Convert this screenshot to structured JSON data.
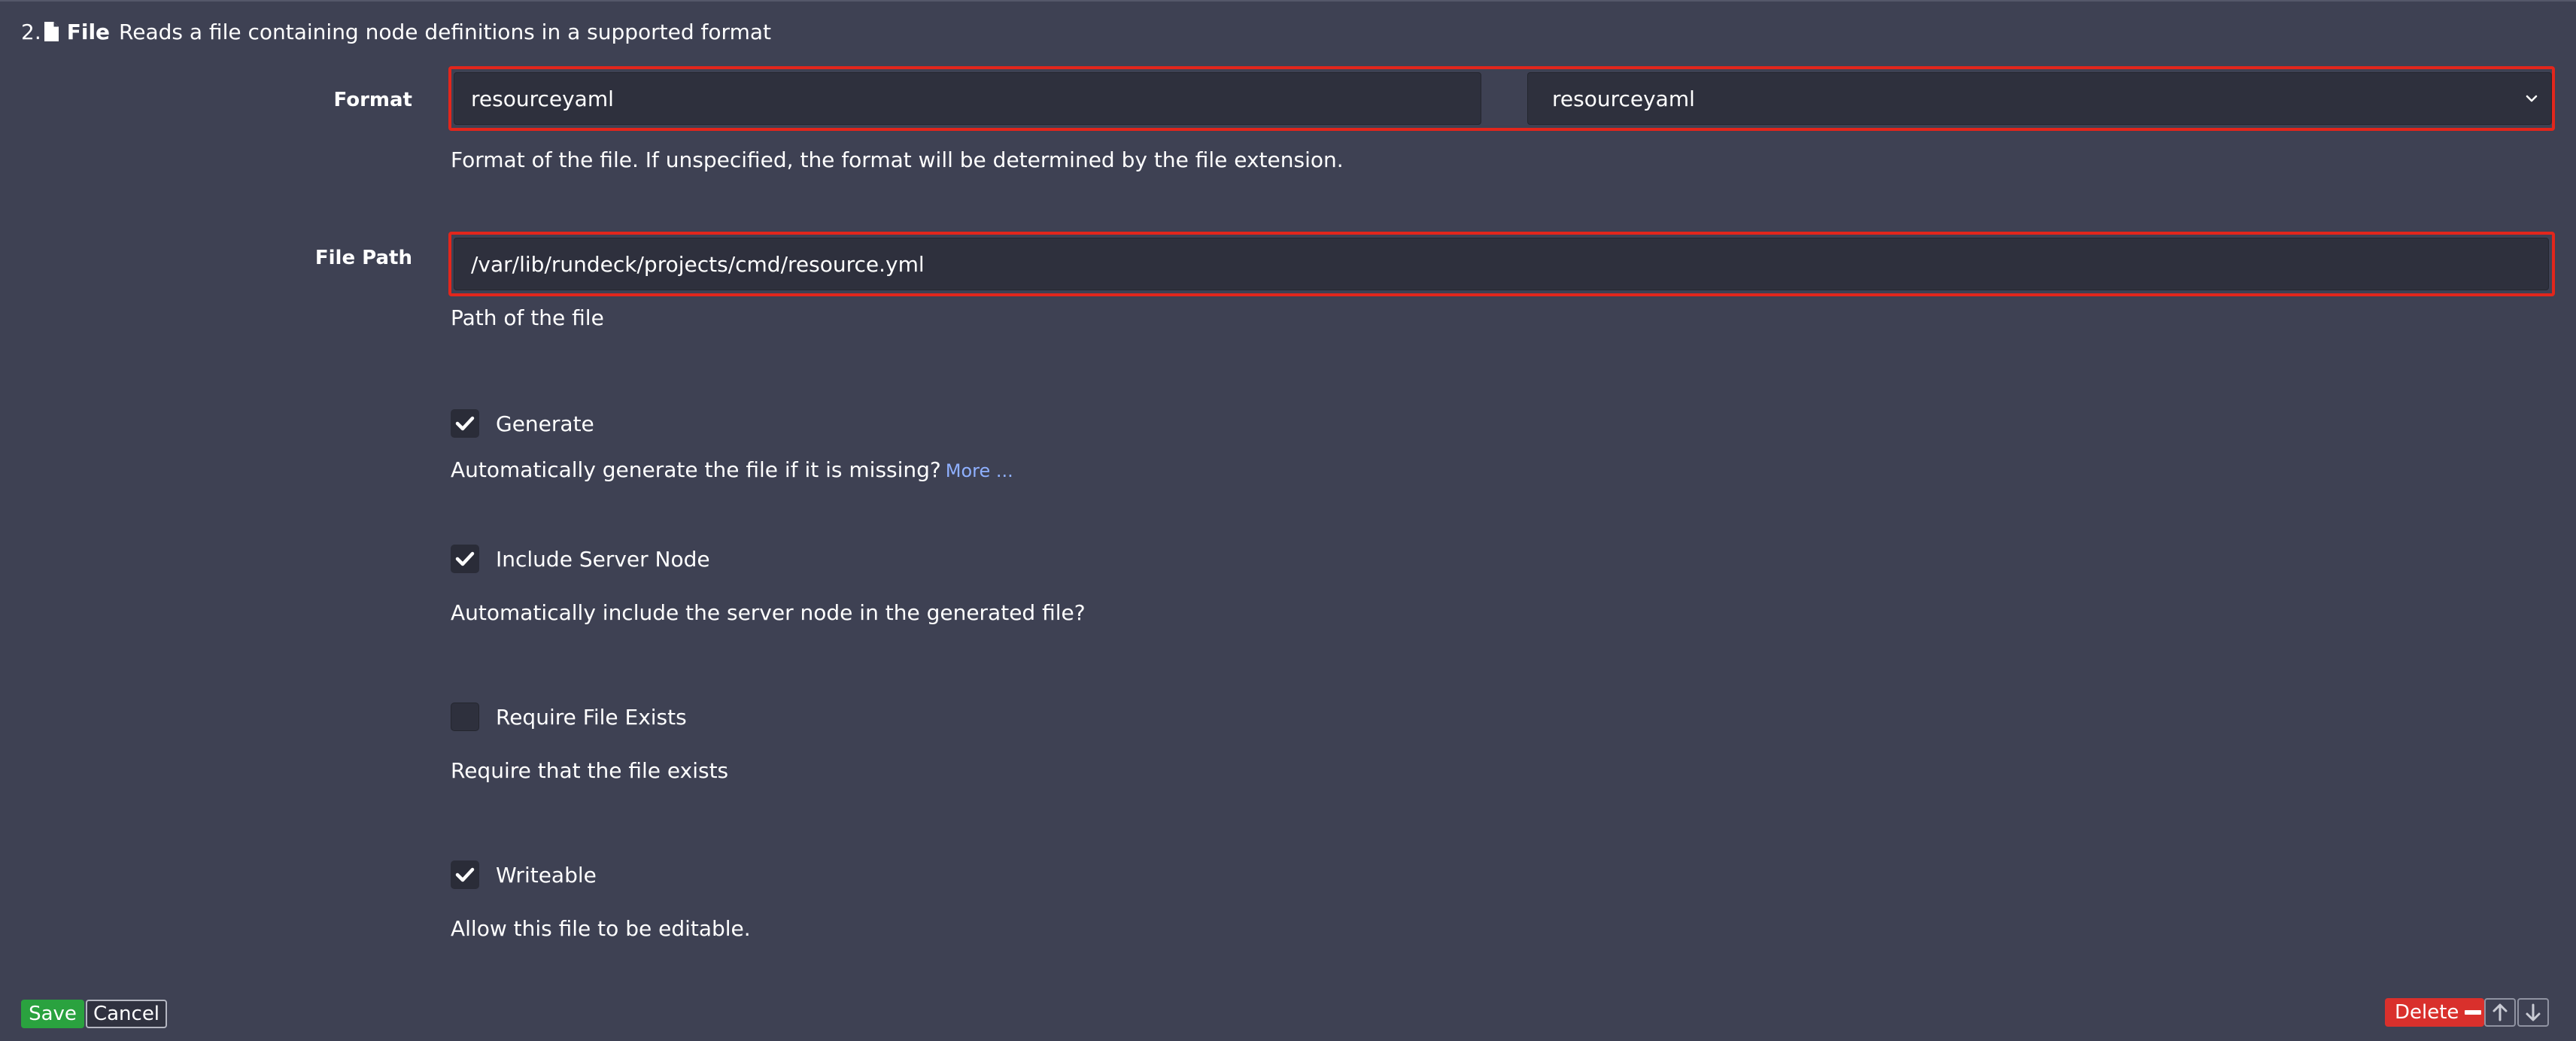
{
  "header": {
    "number": "2.",
    "icon": "file-icon",
    "title": "File",
    "description": "Reads a file containing node definitions in a supported format"
  },
  "format": {
    "label": "Format",
    "text_value": "resourceyaml",
    "select_value": "resourceyaml",
    "help": "Format of the file. If unspecified, the format will be determined by the file extension."
  },
  "file_path": {
    "label": "File Path",
    "value": "/var/lib/rundeck/projects/cmd/resource.yml",
    "help": "Path of the file"
  },
  "generate": {
    "label": "Generate",
    "checked": true,
    "help": "Automatically generate the file if it is missing?",
    "more_link": "More ..."
  },
  "include_server_node": {
    "label": "Include Server Node",
    "checked": true,
    "help": "Automatically include the server node in the generated file?"
  },
  "require_file_exists": {
    "label": "Require File Exists",
    "checked": false,
    "help": "Require that the file exists"
  },
  "writeable": {
    "label": "Writeable",
    "checked": true,
    "help": "Allow this file to be editable."
  },
  "buttons": {
    "save": "Save",
    "cancel": "Cancel",
    "delete": "Delete"
  },
  "colors": {
    "background": "#3e4153",
    "input_background": "#2e303d",
    "highlight_border": "#e2261c",
    "save": "#2aa23f",
    "delete": "#d9302c",
    "link": "#8fb0ff"
  }
}
